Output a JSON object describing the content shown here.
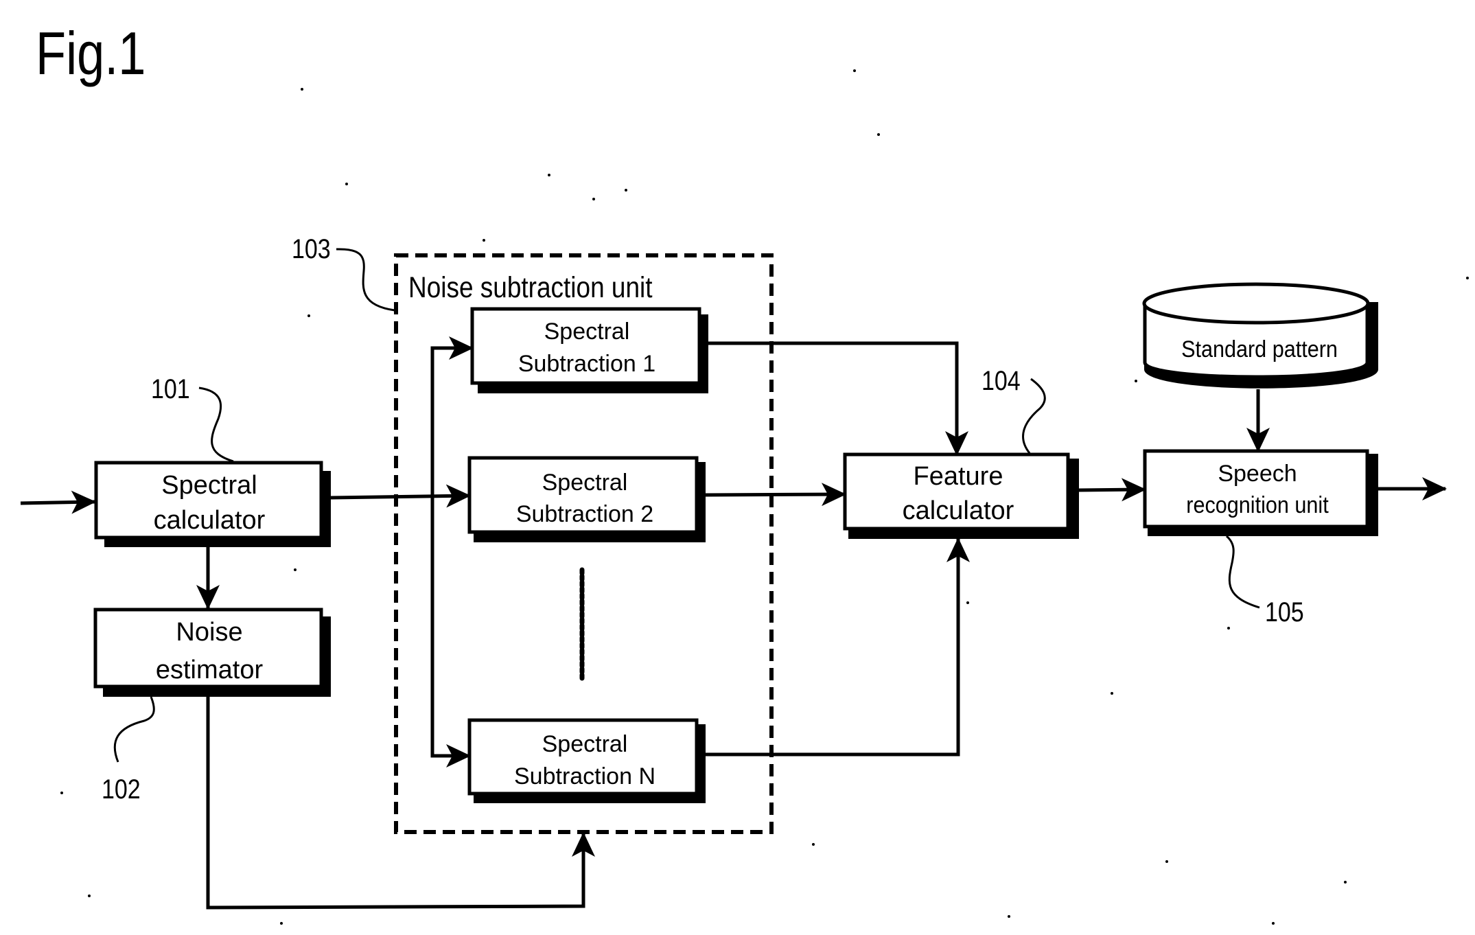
{
  "figure": {
    "title": "Fig.1"
  },
  "blocks": {
    "spectral_calculator": {
      "ref": "101",
      "line1": "Spectral",
      "line2": "calculator"
    },
    "noise_estimator": {
      "ref": "102",
      "line1": "Noise",
      "line2": "estimator"
    },
    "noise_subtraction_unit": {
      "ref": "103",
      "title": "Noise subtraction unit",
      "subtractors": [
        {
          "line1": "Spectral",
          "line2": "Subtraction 1"
        },
        {
          "line1": "Spectral",
          "line2": "Subtraction 2"
        },
        {
          "line1": "Spectral",
          "line2": "Subtraction N"
        }
      ]
    },
    "feature_calculator": {
      "ref": "104",
      "line1": "Feature",
      "line2": "calculator"
    },
    "standard_pattern": {
      "label": "Standard pattern"
    },
    "speech_recognition_unit": {
      "ref": "105",
      "line1": "Speech",
      "line2": "recognition unit"
    }
  },
  "colors": {
    "ink": "#000000",
    "paper": "#ffffff"
  }
}
